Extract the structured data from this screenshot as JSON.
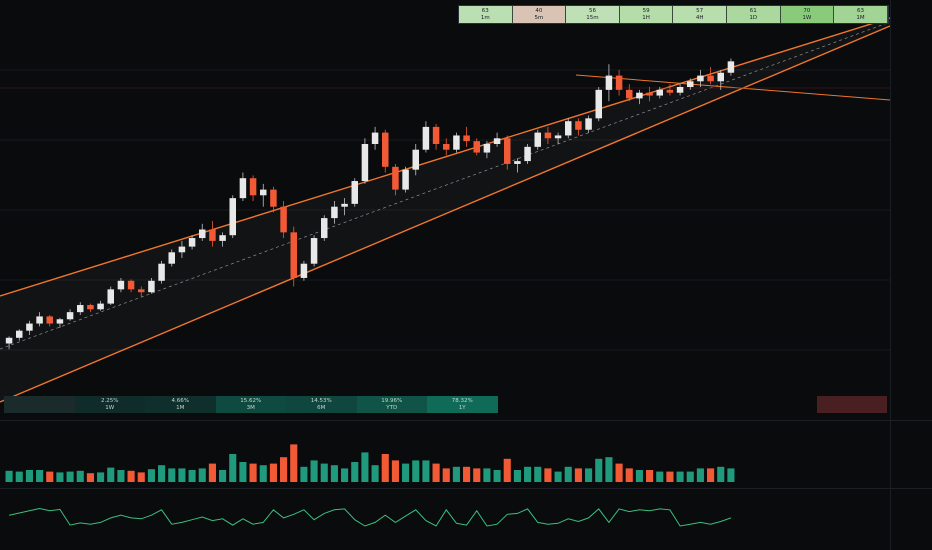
{
  "colors": {
    "background": "#0a0b0d",
    "channel": "#f0752e",
    "up": "#1f9a7c",
    "down": "#f25a36",
    "label_up": "#26a69a",
    "label_down": "#ef5350",
    "grid": "#15181d"
  },
  "timeframe_table": [
    {
      "value": "63",
      "label": "1m",
      "color": "#b9dfb3"
    },
    {
      "value": "40",
      "label": "5m",
      "color": "#d8c3b4"
    },
    {
      "value": "56",
      "label": "15m",
      "color": "#bfe0b6"
    },
    {
      "value": "59",
      "label": "1H",
      "color": "#b4dda9"
    },
    {
      "value": "57",
      "label": "4H",
      "color": "#b8deae"
    },
    {
      "value": "61",
      "label": "1D",
      "color": "#aad89f"
    },
    {
      "value": "70",
      "label": "1W",
      "color": "#8acb7b"
    },
    {
      "value": "63",
      "label": "1M",
      "color": "#a1d495"
    }
  ],
  "performance_table": [
    {
      "value": "",
      "label": "",
      "color": "#1b2a2a"
    },
    {
      "value": "2.25%",
      "label": "1W",
      "color": "#0f2b2a"
    },
    {
      "value": "4.66%",
      "label": "1M",
      "color": "#0f2f2c"
    },
    {
      "value": "15.62%",
      "label": "3M",
      "color": "#0f4a40"
    },
    {
      "value": "14.53%",
      "label": "6M",
      "color": "#0f463d"
    },
    {
      "value": "19.96%",
      "label": "YTD",
      "color": "#0f5446"
    },
    {
      "value": "78.32%",
      "label": "1Y",
      "color": "#0f6b57"
    }
  ],
  "chart_data": {
    "type": "candlestick",
    "ohlc": [
      {
        "o": 10,
        "h": 12.5,
        "l": 8,
        "c": 12
      },
      {
        "o": 12,
        "h": 15,
        "l": 11,
        "c": 14.5
      },
      {
        "o": 14.5,
        "h": 18,
        "l": 13,
        "c": 17
      },
      {
        "o": 17,
        "h": 21,
        "l": 16,
        "c": 19.5
      },
      {
        "o": 19.5,
        "h": 20,
        "l": 16,
        "c": 17
      },
      {
        "o": 17,
        "h": 19,
        "l": 15.5,
        "c": 18.5
      },
      {
        "o": 18.5,
        "h": 22,
        "l": 18,
        "c": 21
      },
      {
        "o": 21,
        "h": 24.5,
        "l": 20,
        "c": 23.5
      },
      {
        "o": 23.5,
        "h": 24,
        "l": 21,
        "c": 22
      },
      {
        "o": 22,
        "h": 25,
        "l": 21.5,
        "c": 24
      },
      {
        "o": 24,
        "h": 30,
        "l": 23.5,
        "c": 29
      },
      {
        "o": 29,
        "h": 33,
        "l": 28,
        "c": 32
      },
      {
        "o": 32,
        "h": 32.5,
        "l": 28,
        "c": 29
      },
      {
        "o": 29,
        "h": 30,
        "l": 26.5,
        "c": 28
      },
      {
        "o": 28,
        "h": 33,
        "l": 27.5,
        "c": 32
      },
      {
        "o": 32,
        "h": 39,
        "l": 31,
        "c": 38
      },
      {
        "o": 38,
        "h": 43,
        "l": 37,
        "c": 42
      },
      {
        "o": 42,
        "h": 46,
        "l": 40,
        "c": 44
      },
      {
        "o": 44,
        "h": 48,
        "l": 43,
        "c": 47
      },
      {
        "o": 47,
        "h": 52,
        "l": 46,
        "c": 50
      },
      {
        "o": 50,
        "h": 53,
        "l": 44,
        "c": 46
      },
      {
        "o": 46,
        "h": 49,
        "l": 44,
        "c": 48
      },
      {
        "o": 48,
        "h": 62,
        "l": 47,
        "c": 61
      },
      {
        "o": 61,
        "h": 70,
        "l": 60,
        "c": 68
      },
      {
        "o": 68,
        "h": 69,
        "l": 60,
        "c": 62
      },
      {
        "o": 62,
        "h": 66,
        "l": 58,
        "c": 64
      },
      {
        "o": 64,
        "h": 65,
        "l": 56,
        "c": 58
      },
      {
        "o": 58,
        "h": 60,
        "l": 47,
        "c": 49
      },
      {
        "o": 49,
        "h": 51,
        "l": 30,
        "c": 33
      },
      {
        "o": 33,
        "h": 39,
        "l": 32,
        "c": 38
      },
      {
        "o": 38,
        "h": 48,
        "l": 37,
        "c": 47
      },
      {
        "o": 47,
        "h": 55,
        "l": 46,
        "c": 54
      },
      {
        "o": 54,
        "h": 60,
        "l": 52,
        "c": 58
      },
      {
        "o": 58,
        "h": 61,
        "l": 55,
        "c": 59
      },
      {
        "o": 59,
        "h": 68,
        "l": 58,
        "c": 67
      },
      {
        "o": 67,
        "h": 82,
        "l": 66,
        "c": 80
      },
      {
        "o": 80,
        "h": 86,
        "l": 78,
        "c": 84
      },
      {
        "o": 84,
        "h": 85,
        "l": 70,
        "c": 72
      },
      {
        "o": 72,
        "h": 73,
        "l": 62,
        "c": 64
      },
      {
        "o": 64,
        "h": 72,
        "l": 63,
        "c": 71
      },
      {
        "o": 71,
        "h": 80,
        "l": 69,
        "c": 78
      },
      {
        "o": 78,
        "h": 88,
        "l": 77,
        "c": 86
      },
      {
        "o": 86,
        "h": 87,
        "l": 78,
        "c": 80
      },
      {
        "o": 80,
        "h": 82,
        "l": 76,
        "c": 78
      },
      {
        "o": 78,
        "h": 84,
        "l": 77,
        "c": 83
      },
      {
        "o": 83,
        "h": 86,
        "l": 79,
        "c": 81
      },
      {
        "o": 81,
        "h": 82,
        "l": 76,
        "c": 77
      },
      {
        "o": 77,
        "h": 81,
        "l": 75,
        "c": 80
      },
      {
        "o": 80,
        "h": 84,
        "l": 79,
        "c": 82
      },
      {
        "o": 82,
        "h": 83,
        "l": 71,
        "c": 73
      },
      {
        "o": 73,
        "h": 75,
        "l": 70,
        "c": 74
      },
      {
        "o": 74,
        "h": 80,
        "l": 73,
        "c": 79
      },
      {
        "o": 79,
        "h": 85,
        "l": 78,
        "c": 84
      },
      {
        "o": 84,
        "h": 86,
        "l": 80,
        "c": 82
      },
      {
        "o": 82,
        "h": 84,
        "l": 80,
        "c": 83
      },
      {
        "o": 83,
        "h": 89,
        "l": 82,
        "c": 88
      },
      {
        "o": 88,
        "h": 89,
        "l": 83,
        "c": 85
      },
      {
        "o": 85,
        "h": 90,
        "l": 84,
        "c": 89
      },
      {
        "o": 89,
        "h": 100,
        "l": 88,
        "c": 99
      },
      {
        "o": 99,
        "h": 108,
        "l": 95,
        "c": 104
      },
      {
        "o": 104,
        "h": 106,
        "l": 97,
        "c": 99
      },
      {
        "o": 99,
        "h": 101,
        "l": 95,
        "c": 96
      },
      {
        "o": 96,
        "h": 99,
        "l": 94,
        "c": 98
      },
      {
        "o": 98,
        "h": 100,
        "l": 95,
        "c": 97
      },
      {
        "o": 97,
        "h": 100,
        "l": 96,
        "c": 99
      },
      {
        "o": 99,
        "h": 101,
        "l": 97,
        "c": 98
      },
      {
        "o": 98,
        "h": 101,
        "l": 97,
        "c": 100
      },
      {
        "o": 100,
        "h": 103,
        "l": 99,
        "c": 102
      },
      {
        "o": 102,
        "h": 106,
        "l": 100,
        "c": 104
      },
      {
        "o": 104,
        "h": 107,
        "l": 101,
        "c": 102
      },
      {
        "o": 102,
        "h": 106,
        "l": 99,
        "c": 105
      },
      {
        "o": 105,
        "h": 110,
        "l": 104,
        "c": 109
      }
    ]
  }
}
